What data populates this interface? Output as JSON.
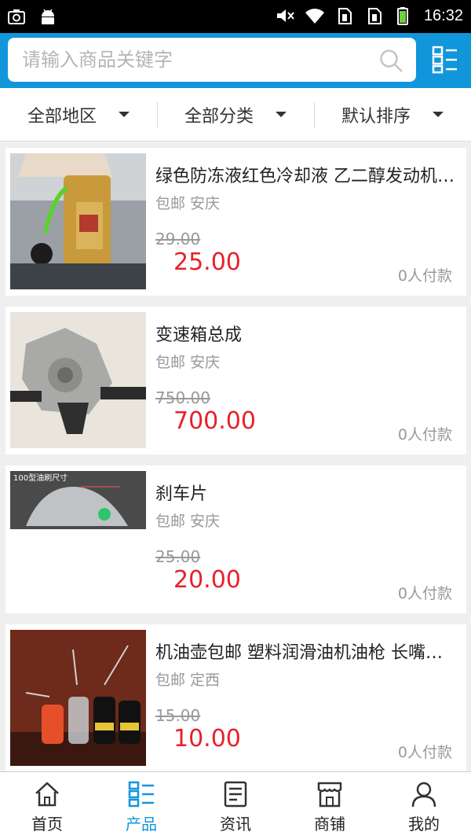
{
  "status_bar": {
    "time": "16:32",
    "left_icons": [
      "screenshot-icon",
      "android-icon"
    ],
    "right_icons": [
      "mute-icon",
      "wifi-icon",
      "sim1-icon",
      "sim2-icon",
      "battery-icon"
    ]
  },
  "search": {
    "placeholder": "请输入商品关键字",
    "search_icon": "search-icon",
    "menu_icon": "list-menu-icon"
  },
  "filters": [
    {
      "label": "全部地区"
    },
    {
      "label": "全部分类"
    },
    {
      "label": "默认排序"
    }
  ],
  "products": [
    {
      "title": "绿色防冻液红色冷却液 乙二醇发动机水箱宝",
      "shipping": "包邮",
      "location": "安庆",
      "old_price": "29.00",
      "price": "25.00",
      "sold": "0人付款"
    },
    {
      "title": "变速箱总成",
      "shipping": "包邮",
      "location": "安庆",
      "old_price": "750.00",
      "price": "700.00",
      "sold": "0人付款"
    },
    {
      "title": "刹车片",
      "shipping": "包邮",
      "location": "安庆",
      "old_price": "25.00",
      "price": "20.00",
      "sold": "0人付款"
    },
    {
      "title": "机油壶包邮 塑料润滑油机油枪 长嘴油壶",
      "shipping": "包邮",
      "location": "定西",
      "old_price": "15.00",
      "price": "10.00",
      "sold": "0人付款"
    }
  ],
  "image_labels": {
    "brake_caption": "100型油刷尺寸"
  },
  "tabs": [
    {
      "label": "首页",
      "icon": "home-icon",
      "active": false
    },
    {
      "label": "产品",
      "icon": "products-icon",
      "active": true
    },
    {
      "label": "资讯",
      "icon": "news-icon",
      "active": false
    },
    {
      "label": "商铺",
      "icon": "shop-icon",
      "active": false
    },
    {
      "label": "我的",
      "icon": "user-icon",
      "active": false
    }
  ],
  "colors": {
    "accent": "#1296db",
    "price": "#e8202a"
  }
}
